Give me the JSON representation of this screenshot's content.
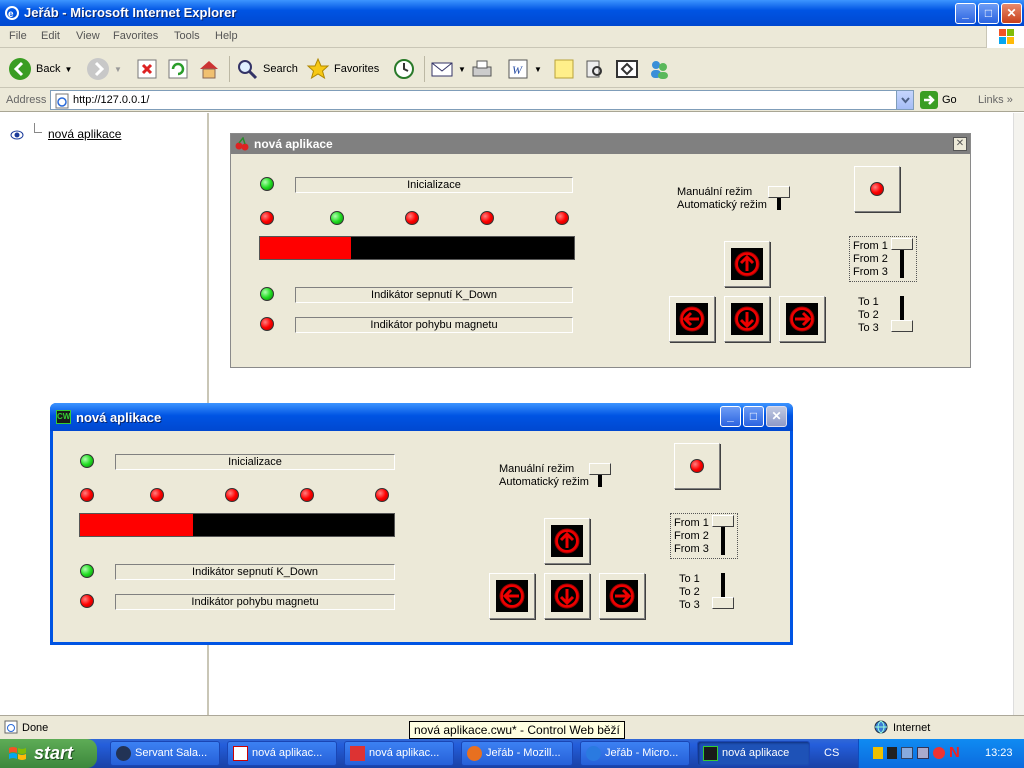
{
  "window": {
    "title": "Jeřáb - Microsoft Internet Explorer",
    "min": "_",
    "max": "□",
    "close": "✕"
  },
  "menu": [
    "File",
    "Edit",
    "View",
    "Favorites",
    "Tools",
    "Help"
  ],
  "toolbar": {
    "back": "Back",
    "search": "Search",
    "favorites": "Favorites"
  },
  "address": {
    "label": "Address",
    "url": "http://127.0.0.1/",
    "go": "Go",
    "links": "Links"
  },
  "tree": {
    "item": "nová aplikace"
  },
  "app": {
    "title": "nová aplikace",
    "init_label": "Inicializace",
    "kdown_label": "Indikátor sepnutí K_Down",
    "magnet_label": "Indikátor pohybu magnetu",
    "mode_manual": "Manuální režim",
    "mode_auto": "Automatický režim",
    "from": [
      "From 1",
      "From 2",
      "From 3"
    ],
    "to": [
      "To 1",
      "To 2",
      "To 3"
    ],
    "progress_fraction": 0.29
  },
  "floating": {
    "title": "nová aplikace",
    "progress_fraction": 0.36
  },
  "status": {
    "text": "Done",
    "zone": "Internet",
    "tooltip": "nová aplikace.cwu* - Control Web běží"
  },
  "taskbar": {
    "start": "start",
    "tasks": [
      "Servant Sala...",
      "nová aplikac...",
      "nová aplikac...",
      "Jeřáb - Mozill...",
      "Jeřáb - Micro...",
      "nová aplikace"
    ],
    "lang": "CS",
    "clock": "13:23"
  },
  "colors": {
    "led_red": "#ff0000",
    "led_green": "#22dd22",
    "xp_blue": "#0054e3",
    "panel": "#ece9d8"
  }
}
